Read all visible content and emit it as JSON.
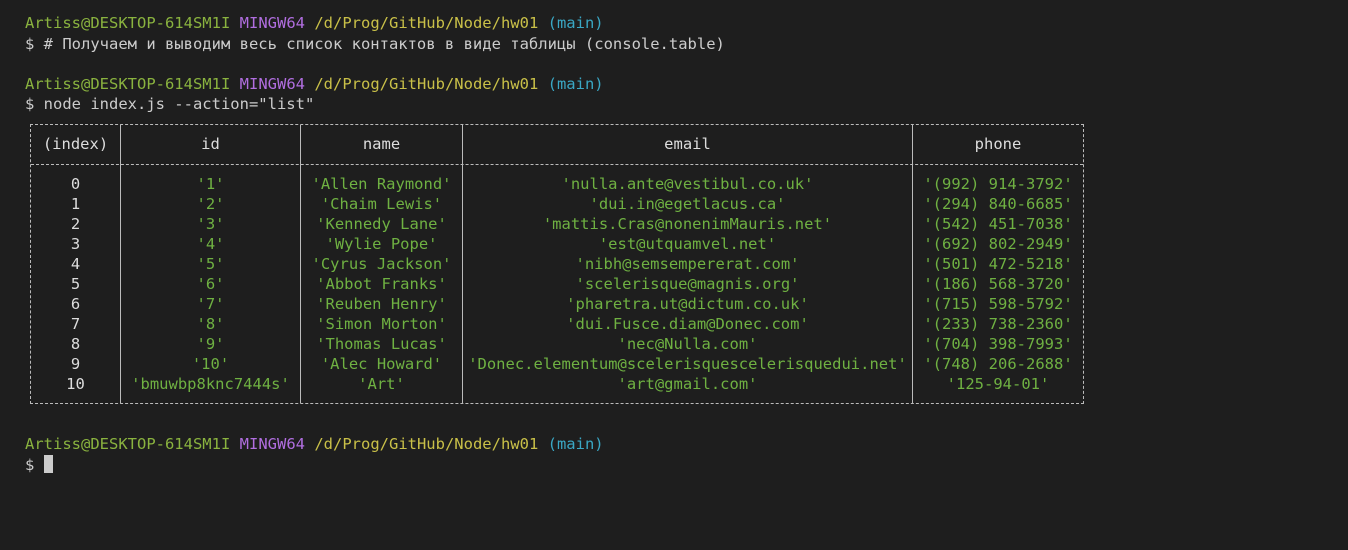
{
  "prompts": [
    {
      "user": "Artiss@DESKTOP-614SM1I",
      "system": "MINGW64",
      "path": "/d/Prog/GitHub/Node/hw01",
      "branch": "(main)",
      "command": "$ # Получаем и выводим весь список контактов в виде таблицы (console.table)"
    },
    {
      "user": "Artiss@DESKTOP-614SM1I",
      "system": "MINGW64",
      "path": "/d/Prog/GitHub/Node/hw01",
      "branch": "(main)",
      "command": "$ node index.js --action=\"list\""
    },
    {
      "user": "Artiss@DESKTOP-614SM1I",
      "system": "MINGW64",
      "path": "/d/Prog/GitHub/Node/hw01",
      "branch": "(main)",
      "command": "$ "
    }
  ],
  "table": {
    "headers": [
      "(index)",
      "id",
      "name",
      "email",
      "phone"
    ],
    "rows": [
      [
        "0",
        "'1'",
        "'Allen Raymond'",
        "'nulla.ante@vestibul.co.uk'",
        "'(992) 914-3792'"
      ],
      [
        "1",
        "'2'",
        "'Chaim Lewis'",
        "'dui.in@egetlacus.ca'",
        "'(294) 840-6685'"
      ],
      [
        "2",
        "'3'",
        "'Kennedy Lane'",
        "'mattis.Cras@nonenimMauris.net'",
        "'(542) 451-7038'"
      ],
      [
        "3",
        "'4'",
        "'Wylie Pope'",
        "'est@utquamvel.net'",
        "'(692) 802-2949'"
      ],
      [
        "4",
        "'5'",
        "'Cyrus Jackson'",
        "'nibh@semsempererat.com'",
        "'(501) 472-5218'"
      ],
      [
        "5",
        "'6'",
        "'Abbot Franks'",
        "'scelerisque@magnis.org'",
        "'(186) 568-3720'"
      ],
      [
        "6",
        "'7'",
        "'Reuben Henry'",
        "'pharetra.ut@dictum.co.uk'",
        "'(715) 598-5792'"
      ],
      [
        "7",
        "'8'",
        "'Simon Morton'",
        "'dui.Fusce.diam@Donec.com'",
        "'(233) 738-2360'"
      ],
      [
        "8",
        "'9'",
        "'Thomas Lucas'",
        "'nec@Nulla.com'",
        "'(704) 398-7993'"
      ],
      [
        "9",
        "'10'",
        "'Alec Howard'",
        "'Donec.elementum@scelerisquescelerisquedui.net'",
        "'(748) 206-2688'"
      ],
      [
        "10",
        "'bmuwbp8knc7444s'",
        "'Art'",
        "'art@gmail.com'",
        "'125-94-01'"
      ]
    ]
  },
  "colors": {
    "background": "#1e1e1e",
    "user": "#8ab33f",
    "system": "#b16ee0",
    "path": "#c9c048",
    "branch": "#3aa7c4",
    "string": "#6fb142"
  }
}
